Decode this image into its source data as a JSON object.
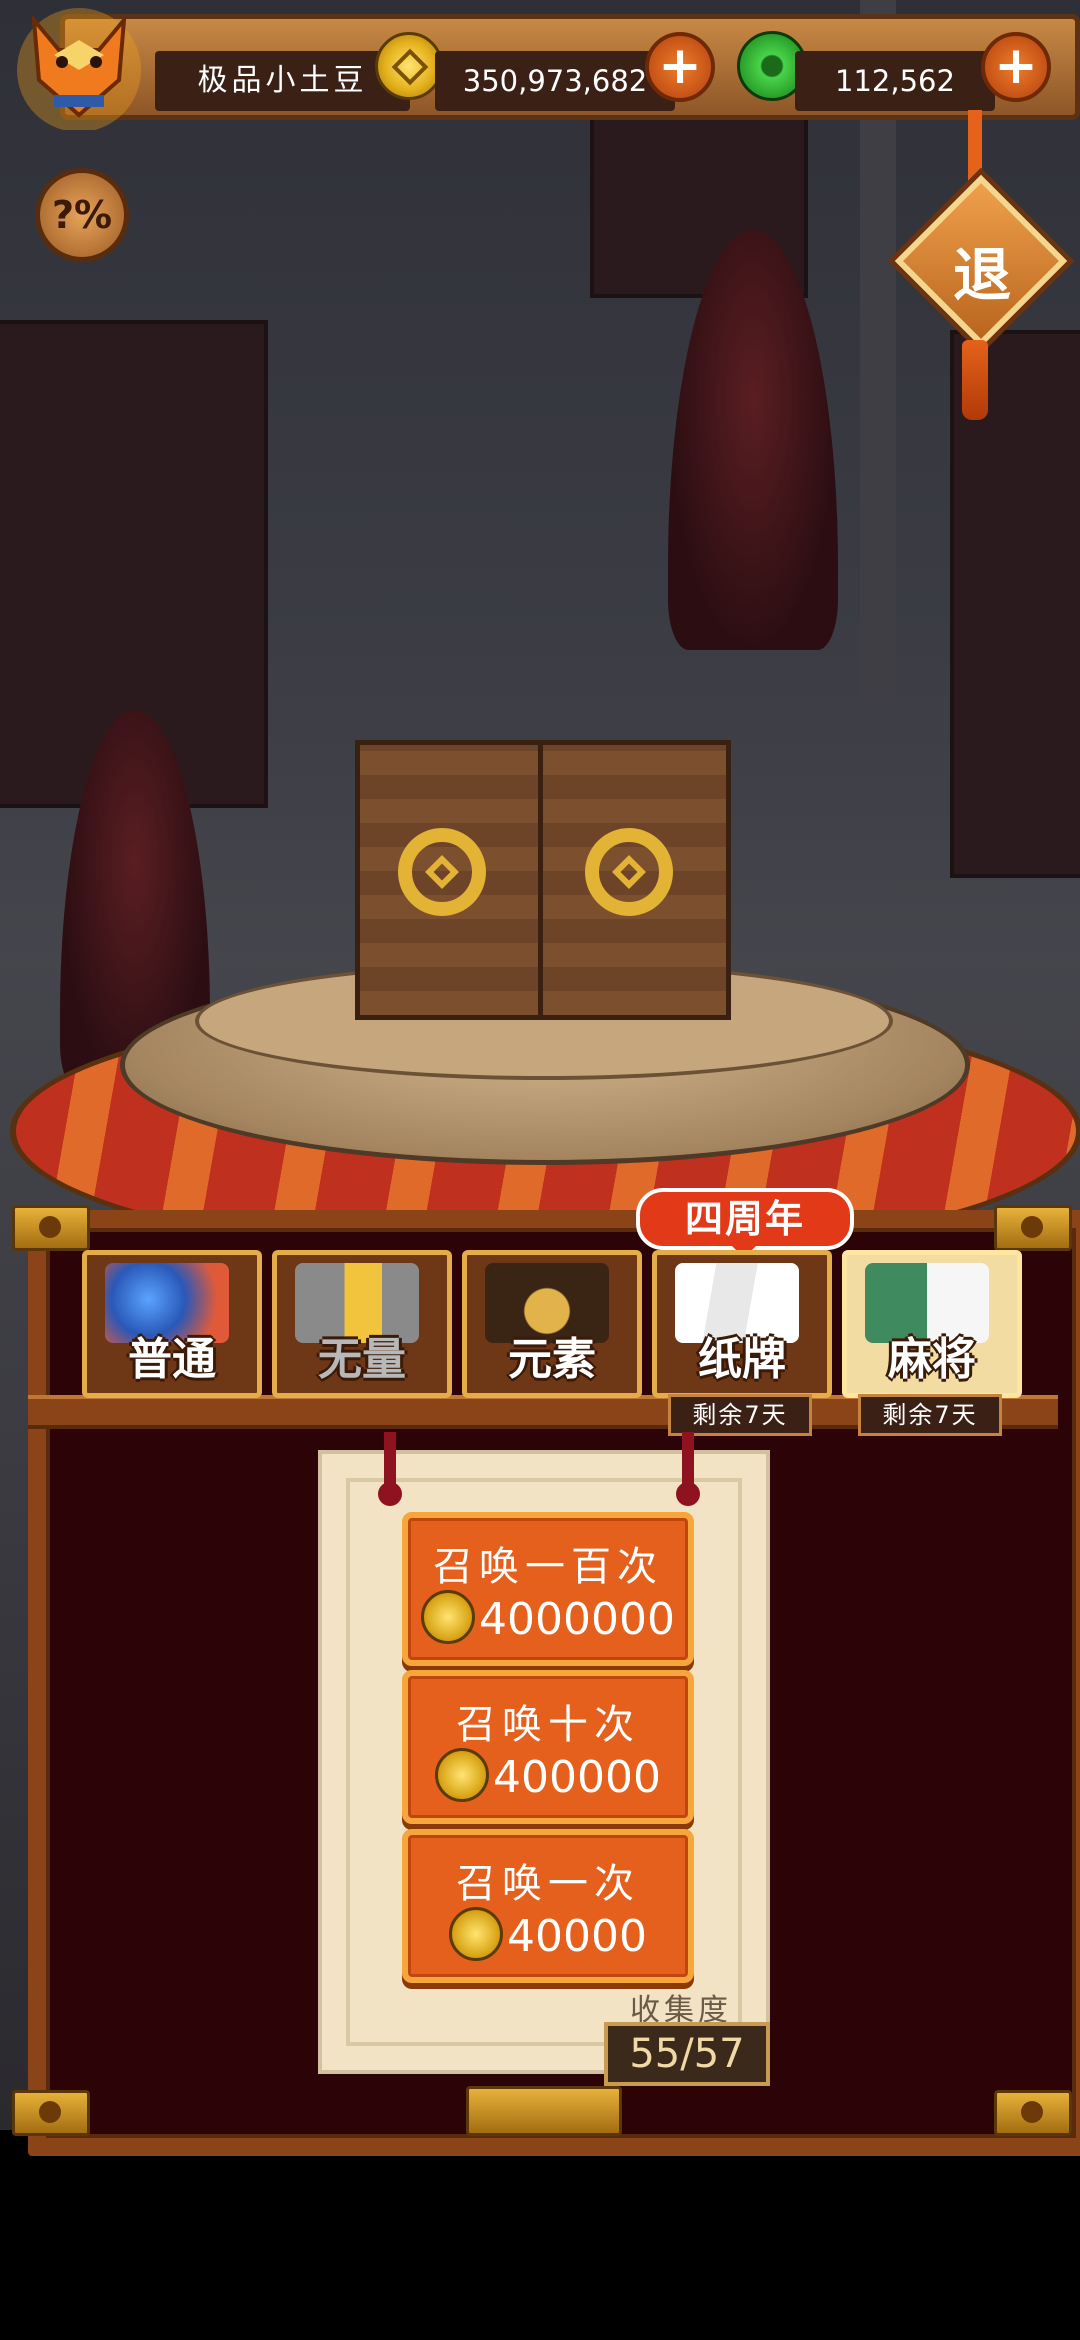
{
  "player": {
    "name": "极品小土豆"
  },
  "resources": {
    "coins": "350,973,682",
    "jade": "112,562"
  },
  "buttons": {
    "help_label": "?%",
    "exit_label": "退",
    "plus_symbol": "+"
  },
  "event_badge": "四周年",
  "tabs": [
    {
      "label": "普通",
      "active": false
    },
    {
      "label": "无量",
      "active": false
    },
    {
      "label": "元素",
      "active": false
    },
    {
      "label": "纸牌",
      "active": false,
      "remaining": "剩余7天"
    },
    {
      "label": "麻将",
      "active": true,
      "remaining": "剩余7天"
    }
  ],
  "summon_options": [
    {
      "title": "召唤一百次",
      "cost": "4000000"
    },
    {
      "title": "召唤十次",
      "cost": "400000"
    },
    {
      "title": "召唤一次",
      "cost": "40000"
    }
  ],
  "collection": {
    "label": "收集度",
    "value": "55/57"
  },
  "colors": {
    "accent_orange": "#e4601c",
    "panel_red": "#2c0407",
    "frame_brown": "#8a4418",
    "gold": "#e2b334"
  }
}
